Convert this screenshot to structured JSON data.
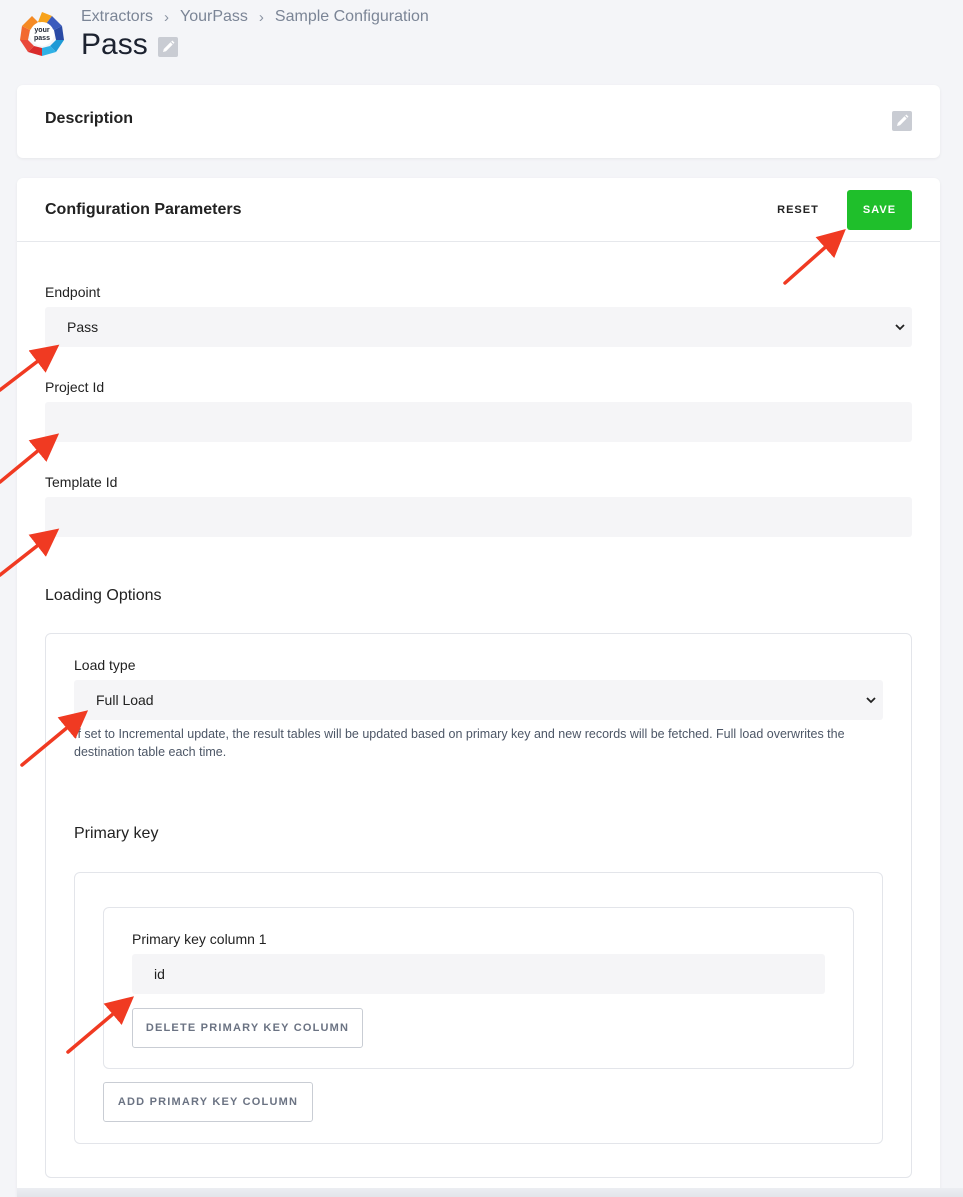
{
  "breadcrumb": [
    "Extractors",
    "YourPass",
    "Sample Configuration"
  ],
  "page_title": "Pass",
  "logo_text": "your pass",
  "description": {
    "label": "Description"
  },
  "config": {
    "label": "Configuration Parameters",
    "reset_label": "RESET",
    "save_label": "SAVE",
    "endpoint": {
      "label": "Endpoint",
      "value": "Pass"
    },
    "project_id": {
      "label": "Project Id",
      "value": ""
    },
    "template_id": {
      "label": "Template Id",
      "value": ""
    },
    "loading_options": {
      "title": "Loading Options",
      "load_type": {
        "label": "Load type",
        "value": "Full Load",
        "help": "If set to Incremental update, the result tables will be updated based on primary key and new records will be fetched. Full load overwrites the destination table each time."
      },
      "primary_key": {
        "title": "Primary key",
        "column_label": "Primary key column 1",
        "column_value": "id",
        "delete_label": "DELETE PRIMARY KEY COLUMN",
        "add_label": "ADD PRIMARY KEY COLUMN"
      }
    }
  },
  "colors": {
    "save": "#1fbf2b",
    "arrow": "#f03a22",
    "background": "#f4f5f8"
  }
}
